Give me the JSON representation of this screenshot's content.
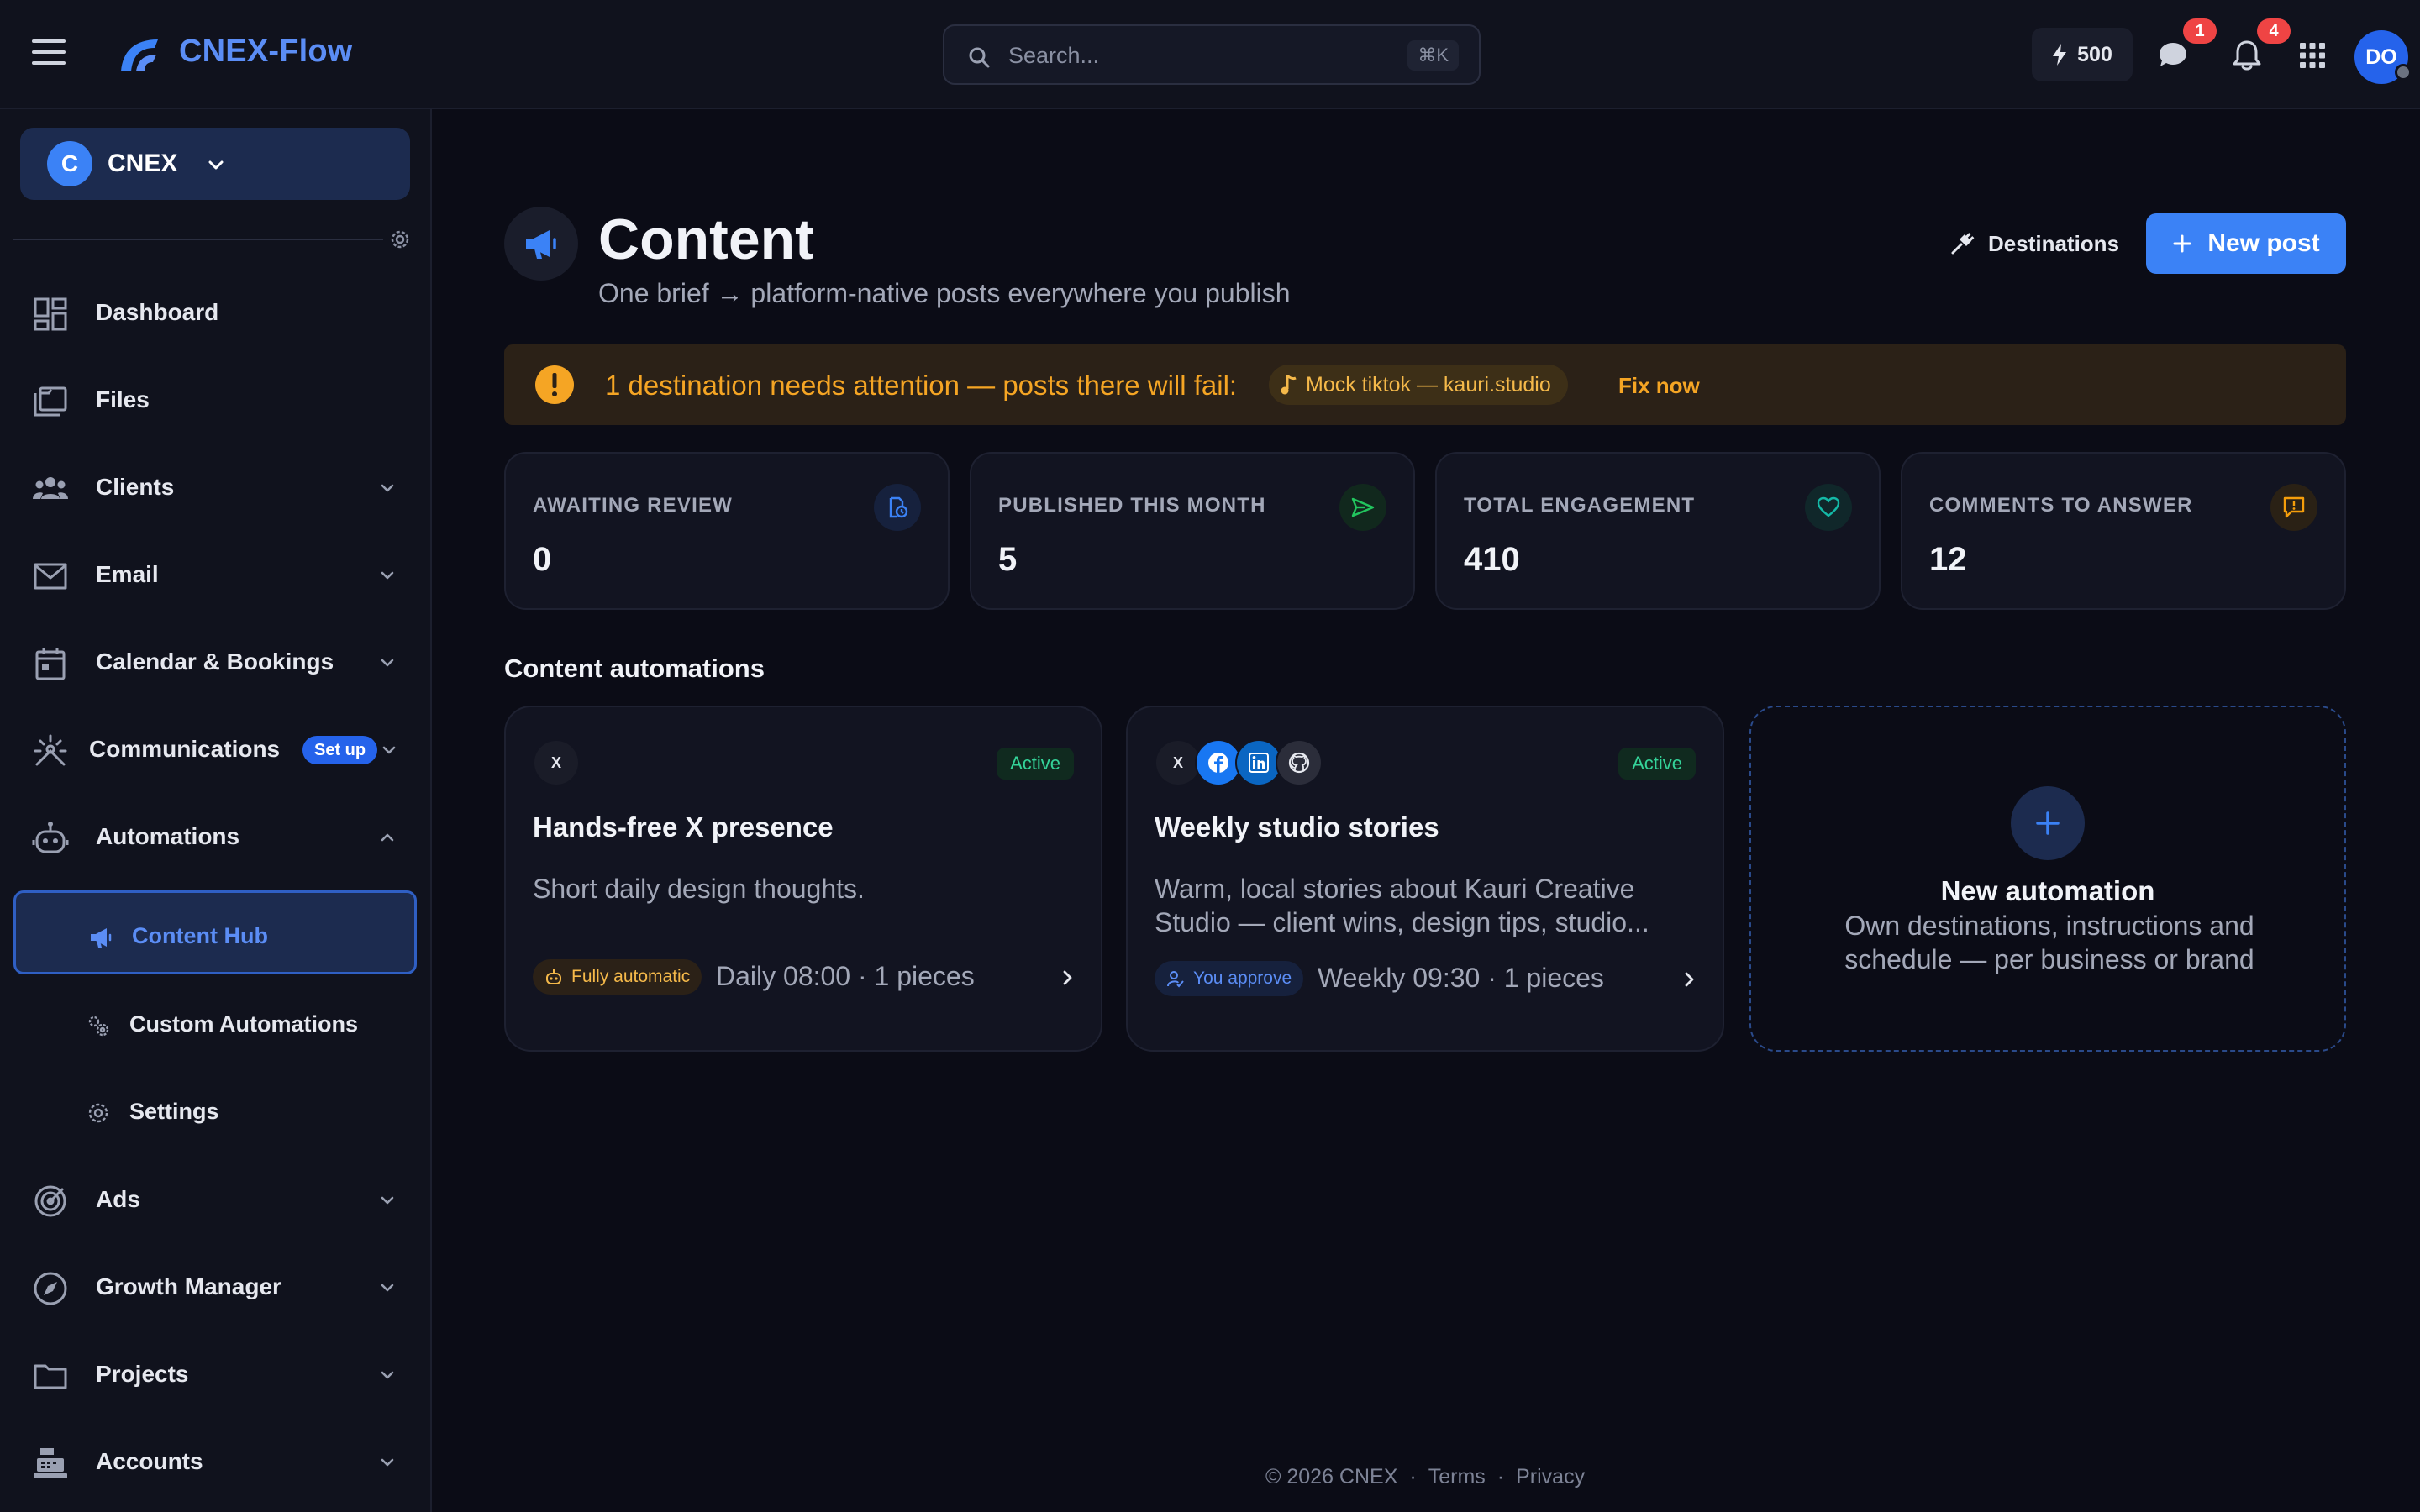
{
  "brand": {
    "name": "CNEX-Flow"
  },
  "search": {
    "placeholder": "Search...",
    "shortcut": "⌘K"
  },
  "topbar": {
    "credits": "500",
    "messages_badge": "1",
    "notifications_badge": "4",
    "avatar_initials": "DO"
  },
  "workspace": {
    "initial": "C",
    "name": "CNEX"
  },
  "sidebar": {
    "items": [
      {
        "label": "Dashboard",
        "icon": "dashboard-icon"
      },
      {
        "label": "Files",
        "icon": "files-icon"
      },
      {
        "label": "Clients",
        "icon": "clients-icon"
      },
      {
        "label": "Email",
        "icon": "email-icon"
      },
      {
        "label": "Calendar & Bookings",
        "icon": "calendar-icon"
      },
      {
        "label": "Communications",
        "icon": "communications-icon",
        "pill": "Set up"
      },
      {
        "label": "Automations",
        "icon": "robot-icon"
      },
      {
        "label": "Ads",
        "icon": "target-icon"
      },
      {
        "label": "Growth Manager",
        "icon": "compass-icon"
      },
      {
        "label": "Projects",
        "icon": "folder-icon"
      },
      {
        "label": "Accounts",
        "icon": "register-icon"
      }
    ],
    "sub_items": [
      {
        "label": "Content Hub",
        "icon": "megaphone-icon",
        "active": true
      },
      {
        "label": "Custom Automations",
        "icon": "gears-icon"
      },
      {
        "label": "Settings",
        "icon": "gear-icon"
      }
    ]
  },
  "header": {
    "title": "Content",
    "subtitle": "One brief → platform-native posts everywhere you publish",
    "destinations_label": "Destinations",
    "new_post_label": "New post"
  },
  "alert": {
    "message": "1 destination needs attention — posts there will fail:",
    "chip": "Mock tiktok — kauri.studio",
    "action": "Fix now"
  },
  "stats": [
    {
      "label": "AWAITING REVIEW",
      "value": "0",
      "color": "#3b82f6"
    },
    {
      "label": "PUBLISHED THIS MONTH",
      "value": "5",
      "color": "#22c55e"
    },
    {
      "label": "TOTAL ENGAGEMENT",
      "value": "410",
      "color": "#14b8a6"
    },
    {
      "label": "COMMENTS TO ANSWER",
      "value": "12",
      "color": "#f59e0b"
    }
  ],
  "automations": {
    "title": "Content automations",
    "cards": [
      {
        "platforms": [
          "X"
        ],
        "status": "Active",
        "title": "Hands-free X presence",
        "description": "Short daily design thoughts.",
        "mode": "Fully automatic",
        "schedule": "Daily 08:00 · 1 pieces"
      },
      {
        "platforms": [
          "X",
          "Facebook",
          "LinkedIn",
          "GitHub"
        ],
        "status": "Active",
        "title": "Weekly studio stories",
        "description": "Warm, local stories about Kauri Creative Studio — client wins, design tips, studio...",
        "mode": "You approve",
        "schedule": "Weekly 09:30 · 1 pieces"
      }
    ],
    "new_card": {
      "title": "New automation",
      "description": "Own destinations, instructions and schedule — per business or brand"
    }
  },
  "footer": {
    "copyright": "© 2026 CNEX",
    "sep": "·",
    "terms": "Terms",
    "privacy": "Privacy"
  },
  "colors": {
    "accent": "#3b82f6",
    "warning": "#f5a524",
    "success": "#34d399",
    "background": "#0b0c16"
  }
}
